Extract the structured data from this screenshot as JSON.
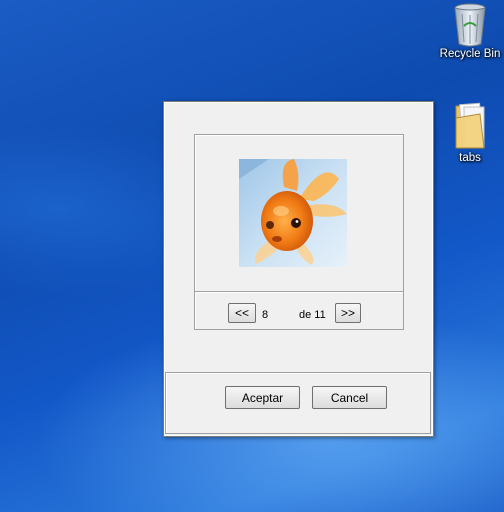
{
  "desktop": {
    "icons": [
      {
        "name": "recycle-bin",
        "label": "Recycle Bin"
      },
      {
        "name": "tabs-folder",
        "label": "tabs"
      }
    ]
  },
  "dialog": {
    "image_alt": "goldfish",
    "nav": {
      "prev_label": "<<",
      "current": "8",
      "of_text": "de 11",
      "next_label": ">>"
    },
    "buttons": {
      "accept_label": "Aceptar",
      "cancel_label": "Cancel"
    }
  }
}
